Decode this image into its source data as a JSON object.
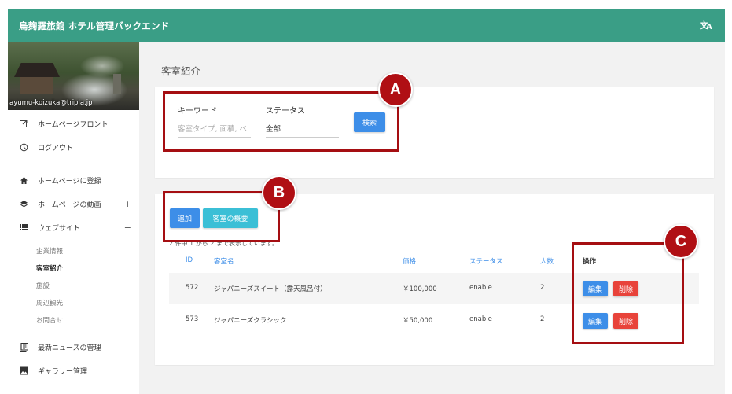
{
  "header": {
    "title": "烏麹羅旅館 ホテル管理バックエンド",
    "translate_icon": "translate-icon"
  },
  "sidebar": {
    "email": "ayumu-koizuka@tripla.jp",
    "items": [
      {
        "label": "ホームページフロント",
        "icon": "external-link-icon"
      },
      {
        "label": "ログアウト",
        "icon": "history-icon"
      },
      {
        "label": "ホームページに登録",
        "icon": "home-icon"
      },
      {
        "label": "ホームページの動画",
        "icon": "layers-icon",
        "toggle": "+"
      },
      {
        "label": "ウェブサイト",
        "icon": "list-icon",
        "toggle": "−"
      },
      {
        "label": "最新ニュースの管理",
        "icon": "news-icon"
      },
      {
        "label": "ギャラリー管理",
        "icon": "image-icon"
      }
    ],
    "sub_items": [
      "企業情報",
      "客室紹介",
      "施設",
      "周辺観光",
      "お問合せ"
    ]
  },
  "main": {
    "page_title": "客室紹介",
    "search": {
      "keyword_label": "キーワード",
      "keyword_placeholder": "客室タイプ, 面積, ベ",
      "status_label": "ステータス",
      "status_value": "全部",
      "search_button": "検索"
    },
    "actions": {
      "add_button": "追加",
      "overview_button": "客室の概要"
    },
    "count_text": "2 件中 1 から 2 まで表示しています。",
    "table": {
      "headers": [
        "ID",
        "客室名",
        "価格",
        "ステータス",
        "人数",
        "操作"
      ],
      "rows": [
        {
          "id": "572",
          "name": "ジャパニーズスイート（露天風呂付）",
          "price": "￥100,000",
          "status": "enable",
          "people": "2",
          "edit": "編集",
          "delete": "削除"
        },
        {
          "id": "573",
          "name": "ジャパニーズクラシック",
          "price": "￥50,000",
          "status": "enable",
          "people": "2",
          "edit": "編集",
          "delete": "削除"
        }
      ]
    }
  },
  "callouts": [
    "A",
    "B",
    "C"
  ],
  "colors": {
    "header": "#3a9e86",
    "primary": "#3d8ee8",
    "danger": "#e8433a",
    "accent": "#3bbfd6",
    "callout": "#a50e12"
  }
}
